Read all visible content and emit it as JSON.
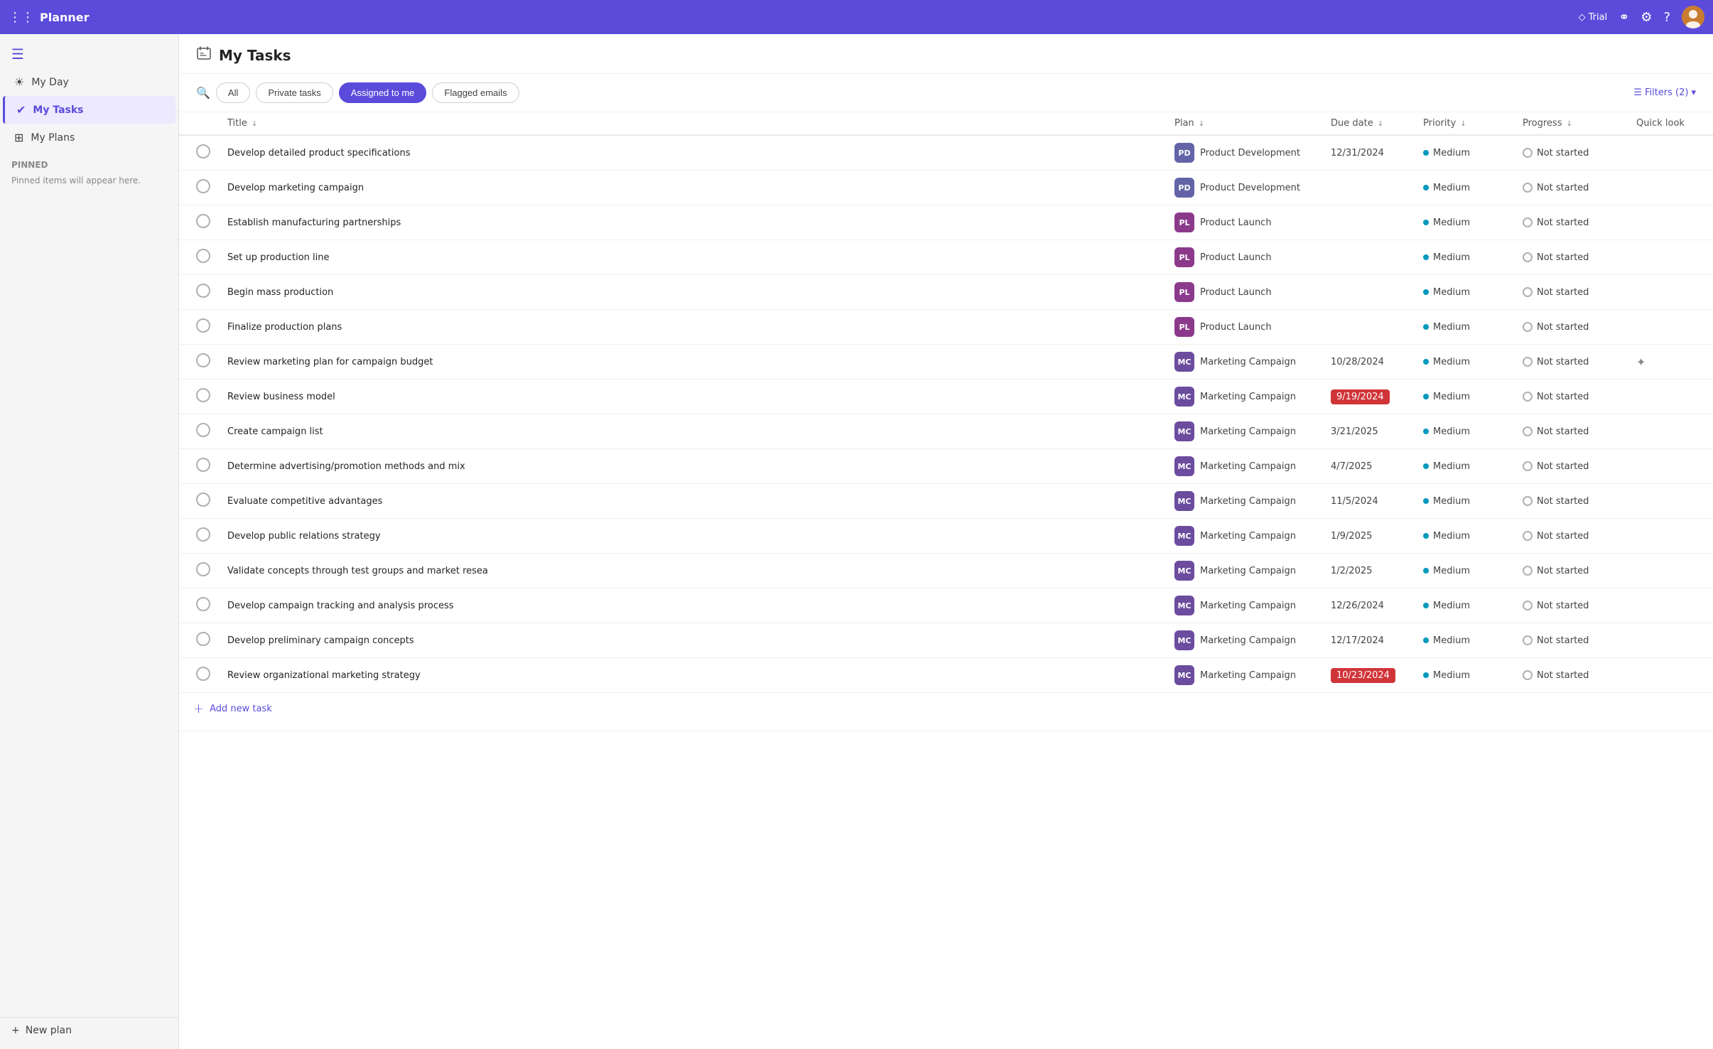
{
  "topbar": {
    "app_name": "Planner",
    "trial_label": "Trial",
    "grid_icon": "⊞",
    "share_icon": "⚭",
    "settings_icon": "⚙",
    "help_icon": "?",
    "avatar_initials": "U"
  },
  "sidebar": {
    "toggle_icon": "☰",
    "items": [
      {
        "id": "my-day",
        "label": "My Day",
        "icon": "☀"
      },
      {
        "id": "my-tasks",
        "label": "My Tasks",
        "icon": "✔",
        "active": true
      },
      {
        "id": "my-plans",
        "label": "My Plans",
        "icon": "⊞"
      }
    ],
    "pinned_section": "Pinned",
    "pinned_empty": "Pinned items will appear here.",
    "new_plan_label": "New plan",
    "new_plan_icon": "+"
  },
  "page": {
    "header_icon": "⌂",
    "title": "My Tasks"
  },
  "filter_bar": {
    "search_icon": "🔍",
    "tabs": [
      {
        "id": "all",
        "label": "All",
        "active": false
      },
      {
        "id": "private-tasks",
        "label": "Private tasks",
        "active": false
      },
      {
        "id": "assigned-to-me",
        "label": "Assigned to me",
        "active": true
      },
      {
        "id": "flagged-emails",
        "label": "Flagged emails",
        "active": false
      }
    ],
    "filters_label": "Filters (2)",
    "filter_icon": "⊟",
    "chevron_icon": "▾"
  },
  "table": {
    "columns": [
      {
        "id": "checkbox",
        "label": ""
      },
      {
        "id": "title",
        "label": "Title",
        "sortable": true
      },
      {
        "id": "plan",
        "label": "Plan",
        "sortable": true
      },
      {
        "id": "due-date",
        "label": "Due date",
        "sortable": true
      },
      {
        "id": "priority",
        "label": "Priority",
        "sortable": true
      },
      {
        "id": "progress",
        "label": "Progress",
        "sortable": true
      },
      {
        "id": "quick-look",
        "label": "Quick look",
        "sortable": false
      }
    ],
    "rows": [
      {
        "title": "Develop detailed product specifications",
        "plan_abbr": "PD",
        "plan_color": "#6264a7",
        "plan_name": "Product Development",
        "due_date": "12/31/2024",
        "due_overdue": false,
        "priority": "Medium",
        "priority_color": "#0099bc",
        "progress": "Not started",
        "has_quick_look": false,
        "show_info": true,
        "show_more": true
      },
      {
        "title": "Develop marketing campaign",
        "plan_abbr": "PD",
        "plan_color": "#6264a7",
        "plan_name": "Product Development",
        "due_date": "",
        "due_overdue": false,
        "priority": "Medium",
        "priority_color": "#0099bc",
        "progress": "Not started",
        "has_quick_look": false
      },
      {
        "title": "Establish manufacturing partnerships",
        "plan_abbr": "PL",
        "plan_color": "#8b3a8b",
        "plan_name": "Product Launch",
        "due_date": "",
        "due_overdue": false,
        "priority": "Medium",
        "priority_color": "#0099bc",
        "progress": "Not started",
        "has_quick_look": false
      },
      {
        "title": "Set up production line",
        "plan_abbr": "PL",
        "plan_color": "#8b3a8b",
        "plan_name": "Product Launch",
        "due_date": "",
        "due_overdue": false,
        "priority": "Medium",
        "priority_color": "#0099bc",
        "progress": "Not started",
        "has_quick_look": false
      },
      {
        "title": "Begin mass production",
        "plan_abbr": "PL",
        "plan_color": "#8b3a8b",
        "plan_name": "Product Launch",
        "due_date": "",
        "due_overdue": false,
        "priority": "Medium",
        "priority_color": "#0099bc",
        "progress": "Not started",
        "has_quick_look": false
      },
      {
        "title": "Finalize production plans",
        "plan_abbr": "PL",
        "plan_color": "#8b3a8b",
        "plan_name": "Product Launch",
        "due_date": "",
        "due_overdue": false,
        "priority": "Medium",
        "priority_color": "#0099bc",
        "progress": "Not started",
        "has_quick_look": false
      },
      {
        "title": "Review marketing plan for campaign budget",
        "plan_abbr": "MC",
        "plan_color": "#6b4c9e",
        "plan_name": "Marketing Campaign",
        "due_date": "10/28/2024",
        "due_overdue": false,
        "priority": "Medium",
        "priority_color": "#0099bc",
        "progress": "Not started",
        "has_quick_look": true
      },
      {
        "title": "Review business model",
        "plan_abbr": "MC",
        "plan_color": "#6b4c9e",
        "plan_name": "Marketing Campaign",
        "due_date": "9/19/2024",
        "due_overdue": true,
        "priority": "Medium",
        "priority_color": "#0099bc",
        "progress": "Not started",
        "has_quick_look": false
      },
      {
        "title": "Create campaign list",
        "plan_abbr": "MC",
        "plan_color": "#6b4c9e",
        "plan_name": "Marketing Campaign",
        "due_date": "3/21/2025",
        "due_overdue": false,
        "priority": "Medium",
        "priority_color": "#0099bc",
        "progress": "Not started",
        "has_quick_look": false
      },
      {
        "title": "Determine advertising/promotion methods and mix",
        "plan_abbr": "MC",
        "plan_color": "#6b4c9e",
        "plan_name": "Marketing Campaign",
        "due_date": "4/7/2025",
        "due_overdue": false,
        "priority": "Medium",
        "priority_color": "#0099bc",
        "progress": "Not started",
        "has_quick_look": false
      },
      {
        "title": "Evaluate competitive advantages",
        "plan_abbr": "MC",
        "plan_color": "#6b4c9e",
        "plan_name": "Marketing Campaign",
        "due_date": "11/5/2024",
        "due_overdue": false,
        "priority": "Medium",
        "priority_color": "#0099bc",
        "progress": "Not started",
        "has_quick_look": false
      },
      {
        "title": "Develop public relations strategy",
        "plan_abbr": "MC",
        "plan_color": "#6b4c9e",
        "plan_name": "Marketing Campaign",
        "due_date": "1/9/2025",
        "due_overdue": false,
        "priority": "Medium",
        "priority_color": "#0099bc",
        "progress": "Not started",
        "has_quick_look": false
      },
      {
        "title": "Validate concepts through test groups and market resea",
        "plan_abbr": "MC",
        "plan_color": "#6b4c9e",
        "plan_name": "Marketing Campaign",
        "due_date": "1/2/2025",
        "due_overdue": false,
        "priority": "Medium",
        "priority_color": "#0099bc",
        "progress": "Not started",
        "has_quick_look": false
      },
      {
        "title": "Develop campaign tracking and analysis process",
        "plan_abbr": "MC",
        "plan_color": "#6b4c9e",
        "plan_name": "Marketing Campaign",
        "due_date": "12/26/2024",
        "due_overdue": false,
        "priority": "Medium",
        "priority_color": "#0099bc",
        "progress": "Not started",
        "has_quick_look": false
      },
      {
        "title": "Develop preliminary campaign concepts",
        "plan_abbr": "MC",
        "plan_color": "#6b4c9e",
        "plan_name": "Marketing Campaign",
        "due_date": "12/17/2024",
        "due_overdue": false,
        "priority": "Medium",
        "priority_color": "#0099bc",
        "progress": "Not started",
        "has_quick_look": false
      },
      {
        "title": "Review organizational marketing strategy",
        "plan_abbr": "MC",
        "plan_color": "#6b4c9e",
        "plan_name": "Marketing Campaign",
        "due_date": "10/23/2024",
        "due_overdue": true,
        "priority": "Medium",
        "priority_color": "#0099bc",
        "progress": "Not started",
        "has_quick_look": false
      }
    ],
    "add_task_label": "Add new task"
  }
}
